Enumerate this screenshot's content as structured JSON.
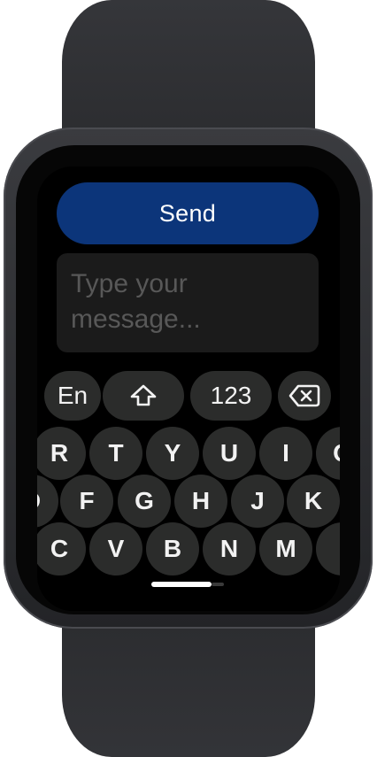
{
  "send_button": {
    "label": "Send"
  },
  "message_input": {
    "placeholder": "Type your message..."
  },
  "keyboard": {
    "language_key": "En",
    "numbers_key": "123",
    "shift_icon": "shift-arrow-icon",
    "backspace_icon": "backspace-icon",
    "row1": [
      "R",
      "T",
      "Y",
      "U",
      "I",
      "O"
    ],
    "row2": [
      "D",
      "F",
      "G",
      "H",
      "J",
      "K"
    ],
    "row3": [
      "C",
      "V",
      "B",
      "N",
      "M",
      ","
    ]
  }
}
